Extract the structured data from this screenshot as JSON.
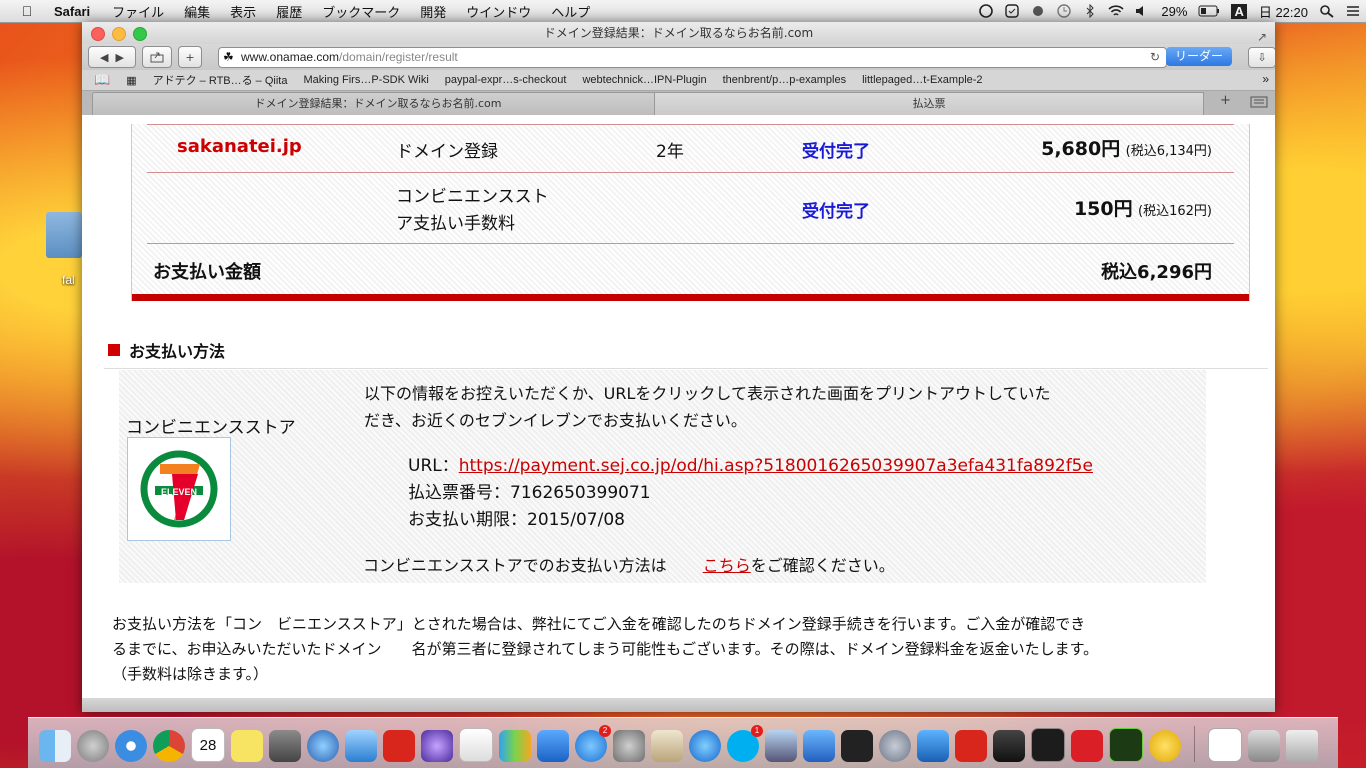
{
  "menubar": {
    "app_name": "Safari",
    "items": [
      "ファイル",
      "編集",
      "表示",
      "履歴",
      "ブックマーク",
      "開発",
      "ウインドウ",
      "ヘルプ"
    ],
    "battery": "29%",
    "input_mode": "A",
    "clock": "日 22:20"
  },
  "desktop": {
    "folder_label": "fal"
  },
  "window": {
    "title": "ドメイン登録結果：ドメイン取るならお名前.com",
    "url_host": "www.onamae.com",
    "url_path": "/domain/register/result",
    "reader_label": "リーダー",
    "bookmarks": [
      "アドテク – RTB…る – Qiita",
      "Making Firs…P-SDK Wiki",
      "paypal-expr…s-checkout",
      "webtechnick…IPN-Plugin",
      "thenbrent/p…p-examples",
      "littlepaged…t-Example-2"
    ],
    "tabs": [
      "ドメイン登録結果：ドメイン取るならお名前.com",
      "払込票"
    ]
  },
  "order": {
    "rows": [
      {
        "domain": "sakanatei.jp",
        "item": "ドメイン登録",
        "period": "2年",
        "status": "受付完了",
        "price": "5,680円",
        "tax": "(税込6,134円)"
      },
      {
        "domain": "",
        "item_line1": "コンビニエンススト",
        "item_line2": "ア支払い手数料",
        "status": "受付完了",
        "price": "150円",
        "tax": "(税込162円)"
      }
    ],
    "total_label": "お支払い金額",
    "total_value": "税込6,296円"
  },
  "payment": {
    "section_title": "お支払い方法",
    "store_label": "コンビニエンスストア",
    "intro_line1": "以下の情報をお控えいただくか、URLをクリックして表示された画面をプリントアウトしていた",
    "intro_line2": "だき、お近くのセブンイレブンでお支払いください。",
    "url_label": "URL：",
    "url_value": "https://payment.sej.co.jp/od/hi.asp?5180016265039907a3efa431fa892f5e",
    "ticket_label": "払込票番号：",
    "ticket_value": "7162650399071",
    "deadline_label": "お支払い期限：",
    "deadline_value": "2015/07/08",
    "help_text_before": "コンビニエンスストアでのお支払い方法は",
    "help_link": "こちら",
    "help_text_after": "をご確認ください。",
    "logo_text": "ELEVEN"
  },
  "note": {
    "line1": "お支払い方法を「コン　ビニエンスストア」とされた場合は、弊社にてご入金を確認したのちドメイン登録手続きを行います。ご入金が確認でき",
    "line2": "るまでに、お申込みいただいたドメイン　　名が第三者に登録されてしまう可能性もございます。その際は、ドメイン登録料金を返金いたします。",
    "line3": "（手数料は除きます。）"
  },
  "dock": {
    "icons": [
      "finder-icon",
      "launchpad-icon",
      "safari-icon",
      "chrome-icon",
      "calendar-icon",
      "stickies-icon",
      "facetime-icon",
      "thunderbird-icon",
      "preview-icon",
      "xmind-icon",
      "imovie-icon",
      "textedit-icon",
      "numbers-icon",
      "keynote-icon",
      "app-store-icon",
      "system-preferences-icon",
      "scripteditor-icon",
      "itunes-icon",
      "skype-icon",
      "iphoto-icon",
      "xcode-icon",
      "unity-icon",
      "r-icon",
      "wireshark-icon",
      "acrobat-icon",
      "x11-icon",
      "terminal-icon",
      "creative-cloud-icon",
      "dreamweaver-icon",
      "cyberduck-icon"
    ],
    "calendar_day": "28",
    "app_store_badge": "2",
    "skype_badge": "1"
  }
}
